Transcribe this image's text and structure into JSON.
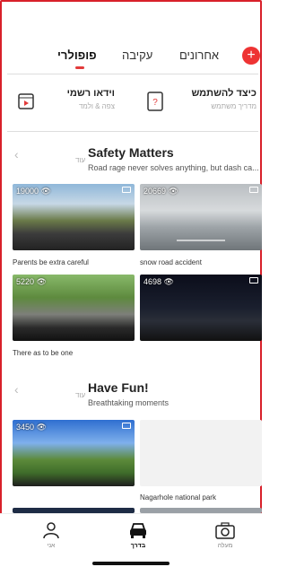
{
  "header": {
    "tabs": [
      {
        "label": "פופולרי",
        "active": true
      },
      {
        "label": "עקיבה",
        "active": false
      },
      {
        "label": "אחרונים",
        "active": false
      }
    ],
    "add_label": "+"
  },
  "features": [
    {
      "title": "כיצד להשתמש",
      "subtitle": "מדריך משתמש",
      "icon": "help-doc-icon"
    },
    {
      "title": "וידאו רשמי",
      "subtitle": "צפה & ולמד",
      "icon": "video-play-icon"
    }
  ],
  "sections": [
    {
      "title": "Safety Matters",
      "subtitle": "Road rage never solves anything, but dash ca...",
      "more": "עוד",
      "videos": [
        {
          "views": "19000",
          "caption": "Parents be extra careful"
        },
        {
          "views": "20669",
          "caption": "snow road accident"
        },
        {
          "views": "5220",
          "caption": "There as to be one"
        },
        {
          "views": "4698",
          "caption": ""
        }
      ]
    },
    {
      "title": "Have Fun!",
      "subtitle": "Breathtaking moments",
      "more": "עוד",
      "videos": [
        {
          "views": "3450",
          "caption": ""
        },
        {
          "views": "",
          "caption": "Nagarhole national park"
        }
      ]
    }
  ],
  "nav": [
    {
      "label": "אני",
      "icon": "person-icon"
    },
    {
      "label": "בדרך",
      "icon": "car-icon",
      "active": true
    },
    {
      "label": "מעלה",
      "icon": "camera-icon"
    }
  ],
  "colors": {
    "accent": "#e23b3b",
    "border": "#d8202a"
  }
}
